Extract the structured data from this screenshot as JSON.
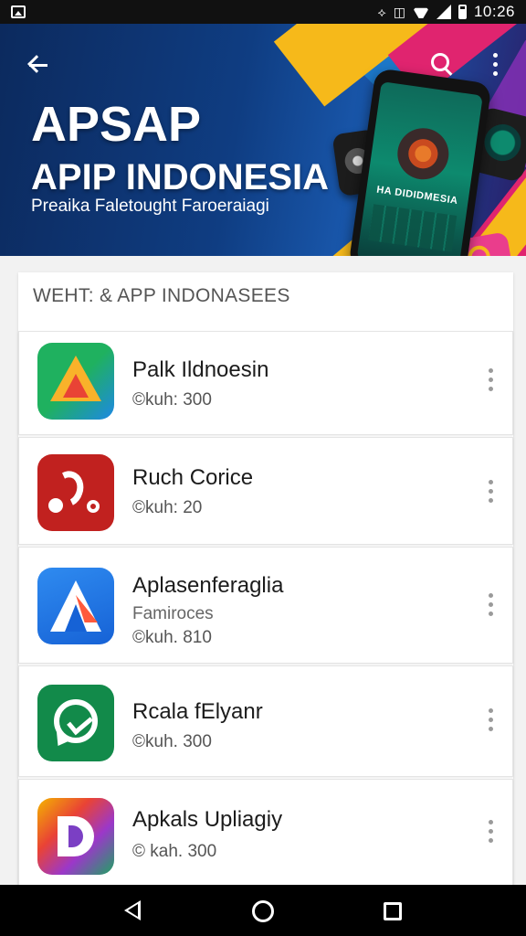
{
  "status_bar": {
    "time": "10:26",
    "icons": [
      "image-notification-icon",
      "vibrate-icon",
      "sim-icon",
      "wifi-icon",
      "signal-icon",
      "battery-icon"
    ]
  },
  "header": {
    "title": "APSAP",
    "subtitle": "APIP INDONESIA",
    "tagline": "Preaika Faletought Faroeraiagi",
    "back_icon": "arrow-back-icon",
    "search_icon": "search-icon",
    "more_icon": "more-vert-icon",
    "device_screen_label": "HA DIDIDMESIA"
  },
  "section": {
    "title": "WEHT: & APP INDONASEES"
  },
  "apps": [
    {
      "name": "Palk Ildnoesin",
      "sub": "",
      "meta": "©kuh: 300",
      "icon": "triangle-logo-icon"
    },
    {
      "name": "Ruch Corice",
      "sub": "",
      "meta": "©kuh: 20",
      "icon": "red-hook-logo-icon"
    },
    {
      "name": "Aplasenferaglia",
      "sub": "Famiroces",
      "meta": "©kuh. 810",
      "icon": "letter-a-logo-icon"
    },
    {
      "name": "Rcala fElyanr",
      "sub": "",
      "meta": "©kuh. 300",
      "icon": "chat-bubble-logo-icon"
    },
    {
      "name": "Apkals Upliagiy",
      "sub": "",
      "meta": "© kah. 300",
      "icon": "multicolor-d-logo-icon"
    }
  ],
  "colors": {
    "banner_dark": "#0c2a5e",
    "accent_yellow": "#f6b91a",
    "accent_pink": "#e0246f",
    "navbar": "#000000"
  },
  "nav_bar": {
    "icons": [
      "nav-back-icon",
      "nav-home-icon",
      "nav-recents-icon"
    ]
  }
}
